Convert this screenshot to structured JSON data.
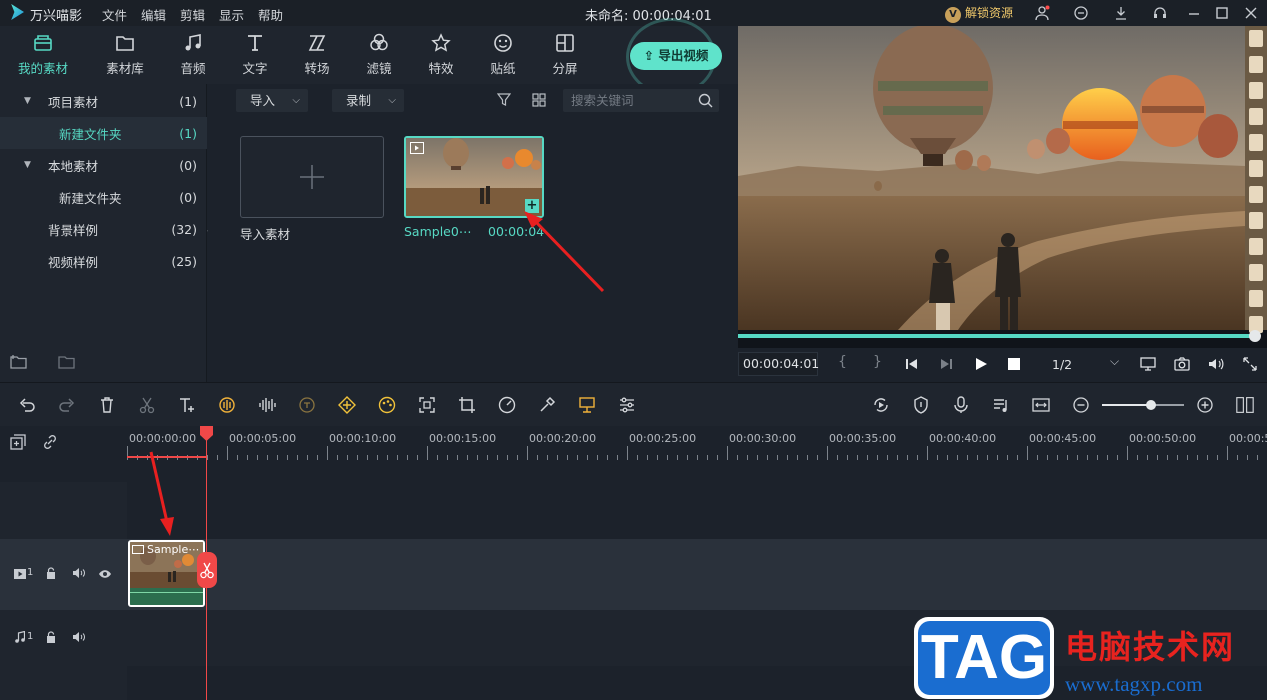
{
  "app": {
    "name": "万兴喵影",
    "doc_title": "未命名: 00:00:04:01",
    "unlock_label": "解锁资源",
    "unlock_badge": "V"
  },
  "menu": [
    "文件",
    "编辑",
    "剪辑",
    "显示",
    "帮助"
  ],
  "toolbar": {
    "tabs": [
      {
        "label": "我的素材",
        "icon": "my-media-icon",
        "active": true
      },
      {
        "label": "素材库",
        "icon": "folder-icon"
      },
      {
        "label": "音频",
        "icon": "music-note-icon"
      },
      {
        "label": "文字",
        "icon": "text-icon"
      },
      {
        "label": "转场",
        "icon": "transition-icon"
      },
      {
        "label": "滤镜",
        "icon": "filter-icon"
      },
      {
        "label": "特效",
        "icon": "effects-star-icon"
      },
      {
        "label": "贴纸",
        "icon": "sticker-icon"
      },
      {
        "label": "分屏",
        "icon": "split-screen-icon"
      }
    ],
    "export_label": "导出视频"
  },
  "library": {
    "items": [
      {
        "label": "项目素材",
        "count": "(1)"
      },
      {
        "label": "新建文件夹",
        "count": "(1)"
      },
      {
        "label": "本地素材",
        "count": "(0)"
      },
      {
        "label": "新建文件夹",
        "count": "(0)"
      },
      {
        "label": "背景样例",
        "count": "(32)"
      },
      {
        "label": "视频样例",
        "count": "(25)"
      }
    ]
  },
  "media": {
    "import_label": "导入",
    "record_label": "录制",
    "search_placeholder": "搜索关键词",
    "import_card_label": "导入素材",
    "clip_name": "Sample0⋯",
    "clip_duration": "00:00:04"
  },
  "preview": {
    "timecode": "00:00:04:01",
    "brace_open": "{",
    "brace_close": "}",
    "quality": "1/2"
  },
  "timeline": {
    "ruler": [
      "00:00:00:00",
      "00:00:05:00",
      "00:00:10:00",
      "00:00:15:00",
      "00:00:20:00",
      "00:00:25:00",
      "00:00:30:00",
      "00:00:35:00",
      "00:00:40:00",
      "00:00:45:00",
      "00:00:50:00",
      "00:00:5"
    ],
    "video_track_num": "1",
    "audio_track_num": "1",
    "clip_label": "Sample⋯"
  },
  "colors": {
    "accent": "#57d9c4",
    "playhead": "#f04848",
    "unlock": "#f1c96b"
  },
  "watermark": {
    "tag": "TAG",
    "title": "电脑技术网",
    "url": "www.tagxp.com"
  }
}
